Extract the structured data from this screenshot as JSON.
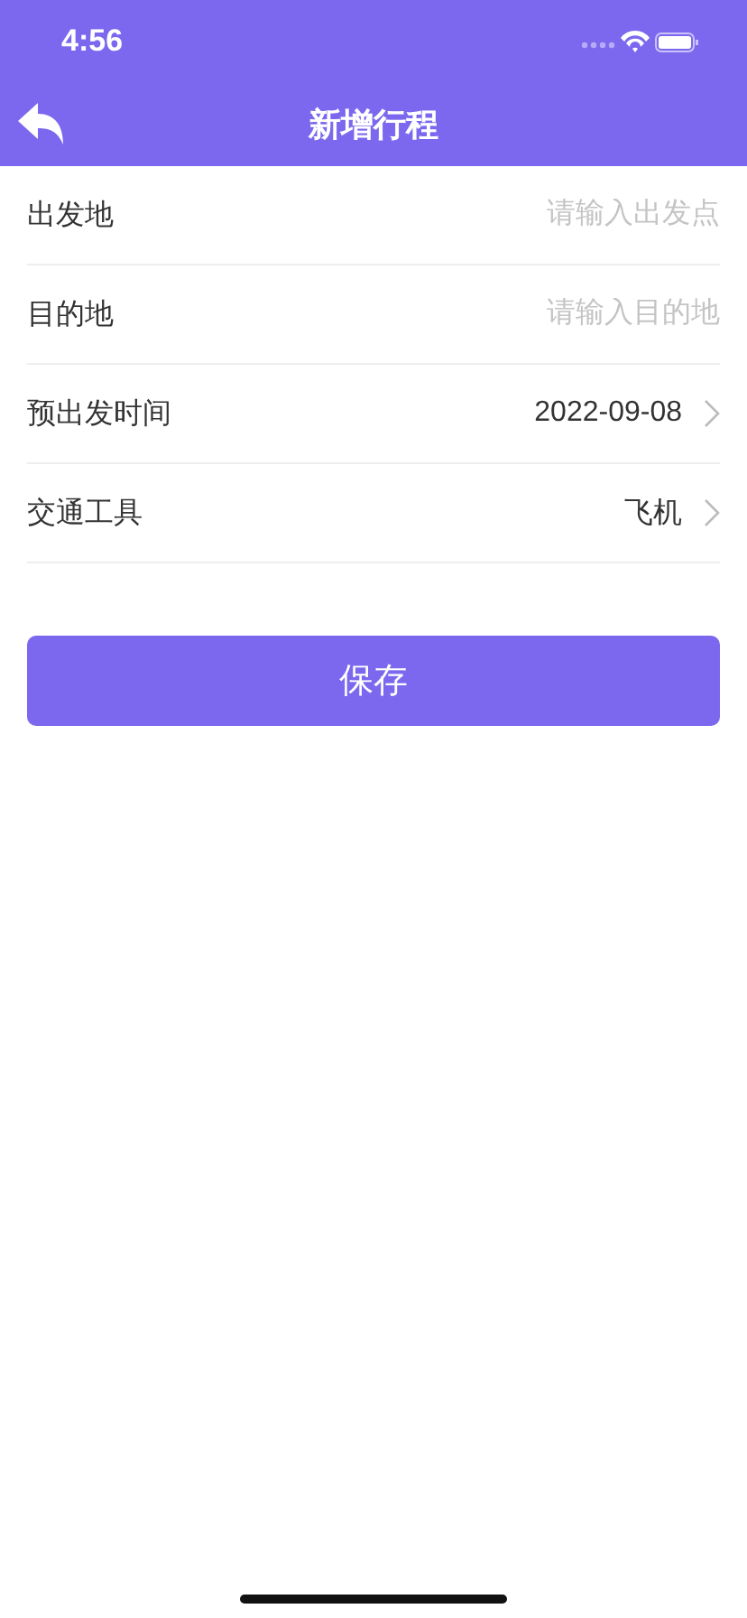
{
  "status_bar": {
    "time": "4:56"
  },
  "nav": {
    "title": "新增行程"
  },
  "fields": [
    {
      "kind": "input",
      "label": "出发地",
      "placeholder": "请输入出发点"
    },
    {
      "kind": "input",
      "label": "目的地",
      "placeholder": "请输入目的地"
    },
    {
      "kind": "picker",
      "label": "预出发时间",
      "value": "2022-09-08"
    },
    {
      "kind": "picker",
      "label": "交通工具",
      "value": "飞机"
    }
  ],
  "save_button": {
    "label": "保存"
  }
}
